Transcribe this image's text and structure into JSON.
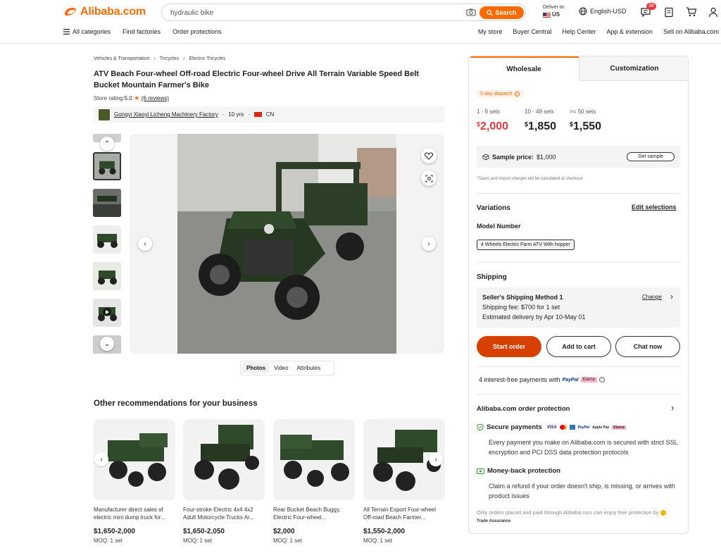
{
  "header": {
    "logo_text": "Alibaba.com",
    "search_value": "hydraulic bike",
    "search_button": "Search",
    "deliver_to_label": "Deliver to:",
    "deliver_to_country": "US",
    "language": "English-USD",
    "message_badge": "38",
    "nav_left": [
      "All categories",
      "Find factories",
      "Order protections"
    ],
    "nav_right": [
      "My store",
      "Buyer Central",
      "Help Center",
      "App & extension",
      "Sell on Alibaba.com"
    ]
  },
  "breadcrumbs": [
    "Vehicles & Transportation",
    "Tricycles",
    "Electric Tricycles"
  ],
  "product": {
    "title": "ATV Beach Four-wheel Off-road Electric Four-wheel Drive All Terrain Variable Speed Belt Bucket Mountain Farmer's Bike",
    "rating_label": "Store rating:",
    "rating_value": "5.0",
    "reviews": "(6 reviews)",
    "store_name": "Gongyi Xiaoyi Licheng Machinery Factory",
    "store_years": "10 yrs",
    "store_country": "CN"
  },
  "media_tabs": [
    "Photos",
    "Video",
    "Attributes"
  ],
  "recommendations": {
    "title": "Other recommendations for your business",
    "items": [
      {
        "name": "Manufacturer direct sales of electric mini dump truck for...",
        "price": "$1,650-2,000",
        "moq": "MOQ: 1 set"
      },
      {
        "name": "Four-stroke Electric 4x4 4x2 Adult Motorcycle Trucks Ar...",
        "price": "$1,650-2,050",
        "moq": "MOQ: 1 set"
      },
      {
        "name": "Rear Bucket Beach Buggy, Electric Four-wheel...",
        "price": "$2,000",
        "moq": "MOQ: 1 set"
      },
      {
        "name": "All Terrain Export Four-wheel Off-road Beach Farmer...",
        "price": "$1,550-2,000",
        "moq": "MOQ: 1 set"
      }
    ]
  },
  "panel": {
    "tabs": [
      "Wholesale",
      "Customization"
    ],
    "dispatch": "5-day dispatch",
    "tiers": [
      {
        "range": "1 - 9 sets",
        "currency": "$",
        "price": "2,000"
      },
      {
        "range": "10 - 49 sets",
        "currency": "$",
        "price": "1,850"
      },
      {
        "range": ">= 50 sets",
        "currency": "$",
        "price": "1,550"
      }
    ],
    "sample_label": "Sample price:",
    "sample_value": "$1,000",
    "get_sample": "Get sample",
    "tax_note": "*Taxes and import charges will be calculated at checkout",
    "variations_title": "Variations",
    "edit_selections": "Edit selections",
    "model_number_label": "Model Number",
    "model_option": "4 Wheels Electric Farm ATV With hopper",
    "shipping_title": "Shipping",
    "shipping_method": "Seller's Shipping Method 1",
    "shipping_change": "Change",
    "shipping_fee": "Shipping fee: $700 for 1 set",
    "delivery": "Estimated delivery by Apr 10-May 01",
    "start_order": "Start order",
    "add_to_cart": "Add to cart",
    "chat_now": "Chat now",
    "interest_free": "4 interest-free payments with",
    "paypal": "PayPal",
    "klarna": "Klarna",
    "protection_title": "Alibaba.com order protection",
    "secure_title": "Secure payments",
    "secure_text": "Every payment you make on Alibaba.com is secured with strict SSL encryption and PCI DSS data protection protocols",
    "money_title": "Money-back protection",
    "money_text": "Claim a refund if your order doesn't ship, is missing, or arrives with product issues",
    "footer_note": "Only orders placed and paid through Alibaba.com can enjoy free protection by",
    "trade_assurance": "Trade Assurance",
    "card_icons": [
      "VISA",
      "mastercard",
      "amex",
      "PayPal",
      "Apple Pay",
      "Klarna"
    ]
  },
  "colors": {
    "accent": "#ff6a00",
    "price_red": "#e4393c",
    "atv_green": "#2f4a2a"
  }
}
